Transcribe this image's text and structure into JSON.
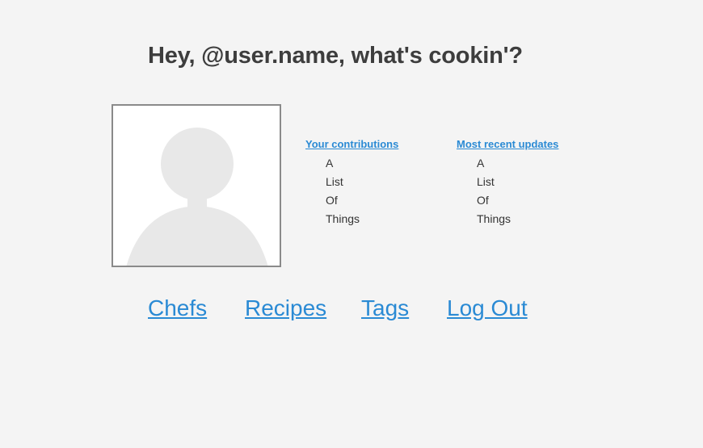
{
  "header": {
    "greeting": "Hey, @user.name, what's cookin'?"
  },
  "profile": {
    "avatar_icon": "person-silhouette-icon"
  },
  "contributions": {
    "heading": "Your contributions",
    "items": [
      "A",
      "List",
      "Of",
      "Things"
    ]
  },
  "recent_updates": {
    "heading": "Most recent updates",
    "items": [
      "A",
      "List",
      "Of",
      "Things"
    ]
  },
  "nav": {
    "chefs": "Chefs",
    "recipes": "Recipes",
    "tags": "Tags",
    "logout": "Log Out"
  },
  "colors": {
    "link": "#2a8ad4",
    "background": "#f4f4f4",
    "heading_text": "#3d3d3d"
  }
}
